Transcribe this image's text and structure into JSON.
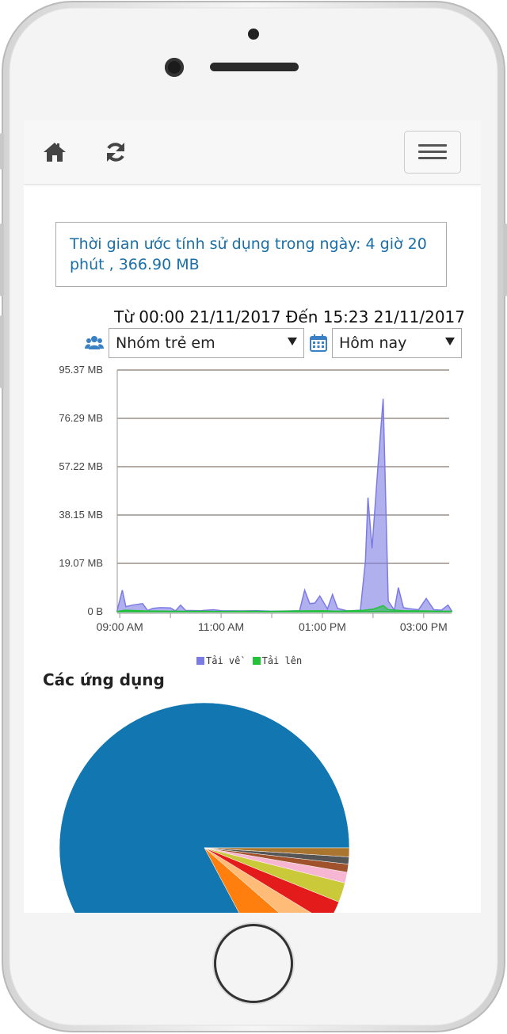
{
  "summary": {
    "text": "Thời gian ước tính sử dụng trong ngày: 4 giờ 20 phút , 366.90 MB"
  },
  "range": {
    "text": "Từ 00:00 21/11/2017 Đến 15:23 21/11/2017"
  },
  "filters": {
    "group": {
      "value": "Nhóm trẻ em",
      "icon": "users-icon"
    },
    "period": {
      "value": "Hôm nay",
      "icon": "calendar-icon"
    }
  },
  "nav": {
    "home_icon": "home-icon",
    "refresh_icon": "refresh-icon",
    "menu_icon": "hamburger-menu-icon"
  },
  "chart_data": [
    {
      "type": "area",
      "y_ticks": [
        "0 B",
        "19.07 MB",
        "38.15 MB",
        "57.22 MB",
        "76.29 MB",
        "95.37 MB"
      ],
      "x_ticks": [
        "09:00 AM",
        "11:00 AM",
        "01:00 PM",
        "03:00 PM"
      ],
      "ylim_mb": [
        0,
        95.37
      ],
      "x_hours": [
        8.95,
        15.55
      ],
      "legend_position": "bottom",
      "grid": true,
      "series": [
        {
          "name": "Tải về",
          "color": "#7b7be5",
          "points": [
            [
              8.95,
              0.6
            ],
            [
              9.05,
              8.5
            ],
            [
              9.12,
              2
            ],
            [
              9.25,
              2.6
            ],
            [
              9.45,
              3.2
            ],
            [
              9.55,
              0.5
            ],
            [
              9.65,
              1.3
            ],
            [
              9.8,
              1.6
            ],
            [
              10.0,
              1.5
            ],
            [
              10.1,
              0.3
            ],
            [
              10.2,
              2.6
            ],
            [
              10.3,
              0.5
            ],
            [
              10.6,
              0.4
            ],
            [
              10.85,
              0.8
            ],
            [
              11.0,
              0.4
            ],
            [
              11.4,
              0.3
            ],
            [
              11.7,
              0.4
            ],
            [
              12.0,
              0.2
            ],
            [
              12.4,
              0.3
            ],
            [
              12.55,
              0.4
            ],
            [
              12.65,
              8.5
            ],
            [
              12.75,
              3.2
            ],
            [
              12.85,
              3.4
            ],
            [
              12.95,
              6.2
            ],
            [
              13.1,
              1.1
            ],
            [
              13.2,
              6.8
            ],
            [
              13.3,
              1.3
            ],
            [
              13.5,
              0.3
            ],
            [
              13.75,
              0.6
            ],
            [
              13.85,
              20
            ],
            [
              13.9,
              45
            ],
            [
              13.98,
              25
            ],
            [
              14.1,
              58
            ],
            [
              14.2,
              84
            ],
            [
              14.3,
              4.2
            ],
            [
              14.42,
              0.6
            ],
            [
              14.5,
              9.5
            ],
            [
              14.6,
              1.6
            ],
            [
              14.7,
              1.2
            ],
            [
              14.9,
              0.8
            ],
            [
              15.05,
              5.2
            ],
            [
              15.2,
              0.8
            ],
            [
              15.35,
              0.6
            ],
            [
              15.48,
              2.6
            ],
            [
              15.55,
              0.4
            ]
          ]
        },
        {
          "name": "Tải lên",
          "color": "#22c23a",
          "points": [
            [
              8.95,
              0.1
            ],
            [
              9.1,
              0.6
            ],
            [
              9.5,
              0.3
            ],
            [
              10.0,
              0.2
            ],
            [
              10.5,
              0.2
            ],
            [
              11.0,
              0.1
            ],
            [
              11.5,
              0.2
            ],
            [
              12.0,
              0.1
            ],
            [
              12.5,
              0.3
            ],
            [
              13.0,
              0.4
            ],
            [
              13.3,
              0.2
            ],
            [
              13.8,
              0.5
            ],
            [
              14.0,
              1.0
            ],
            [
              14.2,
              2.4
            ],
            [
              14.3,
              0.8
            ],
            [
              14.6,
              0.4
            ],
            [
              15.0,
              0.3
            ],
            [
              15.3,
              0.2
            ],
            [
              15.55,
              0.2
            ]
          ]
        }
      ]
    },
    {
      "type": "pie",
      "title": "Các ứng dụng",
      "slices": [
        {
          "value": 82.8,
          "color": "#1276b0"
        },
        {
          "value": 5.8,
          "color": "#ff7f0e"
        },
        {
          "value": 2.7,
          "color": "#ffbb78"
        },
        {
          "value": 2.6,
          "color": "#e41b1b"
        },
        {
          "value": 2.2,
          "color": "#c9c93a"
        },
        {
          "value": 1.2,
          "color": "#f7b6d2"
        },
        {
          "value": 0.9,
          "color": "#a0522d"
        },
        {
          "value": 0.8,
          "color": "#555555"
        },
        {
          "value": 1.0,
          "color": "#a9752f"
        }
      ]
    }
  ]
}
